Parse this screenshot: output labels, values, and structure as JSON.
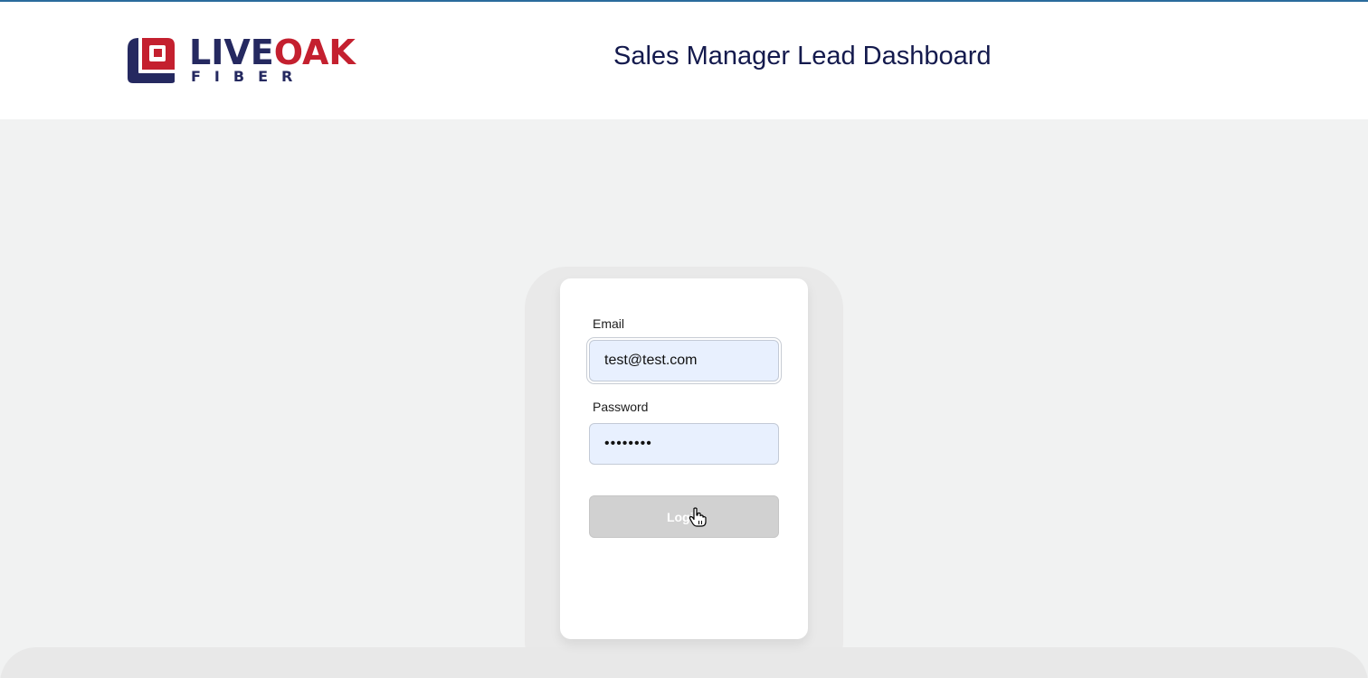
{
  "header": {
    "logo": {
      "main_left": "LIVE",
      "main_right": "OAK",
      "sub": "FIBER",
      "colors": {
        "navy": "#252960",
        "red": "#c4202f"
      }
    },
    "title": "Sales Manager Lead Dashboard"
  },
  "login_form": {
    "email_label": "Email",
    "email_value": "test@test.com",
    "password_label": "Password",
    "password_value": "testtest",
    "login_button_label": "Login"
  },
  "colors": {
    "top_border": "#2a6b9c",
    "page_background": "#f1f2f2",
    "autofill_background": "#e8f0fe",
    "button_disabled": "#d1d1d1",
    "title_color": "#141a4d"
  },
  "icons": {
    "logo_mark": "liveoak-logo-mark",
    "cursor": "hand-pointer-cursor"
  }
}
